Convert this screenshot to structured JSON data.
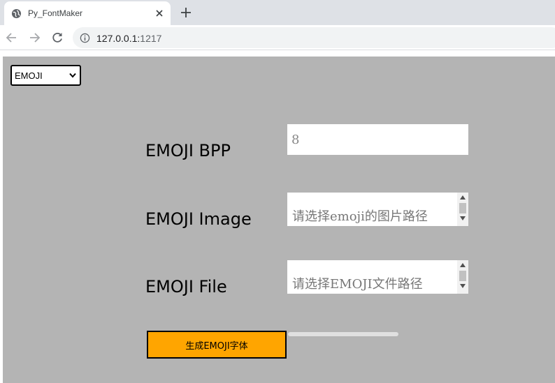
{
  "browser": {
    "tab_title": "Py_FontMaker",
    "url_host": "127.0.0.1:",
    "url_port": "1217"
  },
  "form": {
    "mode_select": {
      "selected": "EMOJI"
    },
    "bpp": {
      "label": "EMOJI BPP",
      "placeholder": "8"
    },
    "image": {
      "label": "EMOJI Image",
      "placeholder": "请选择emoji的图片路径"
    },
    "file": {
      "label": "EMOJI File",
      "placeholder": "请选择EMOJI文件路径"
    },
    "generate_button": "生成EMOJI字体",
    "progress_value": 0
  },
  "colors": {
    "panel_bg": "#b4b4b4",
    "button_bg": "#ffa500"
  }
}
